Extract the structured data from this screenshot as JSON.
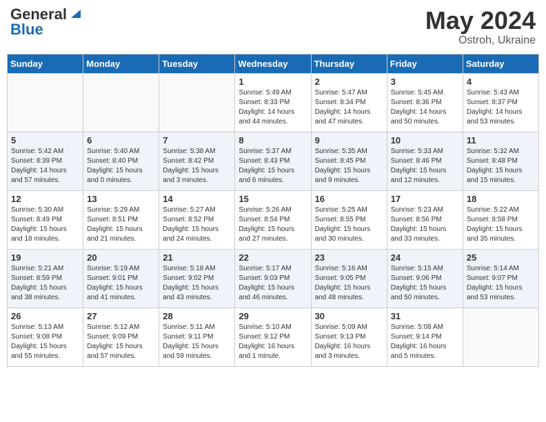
{
  "header": {
    "logo_general": "General",
    "logo_blue": "Blue",
    "month_year": "May 2024",
    "location": "Ostroh, Ukraine"
  },
  "calendar": {
    "days_of_week": [
      "Sunday",
      "Monday",
      "Tuesday",
      "Wednesday",
      "Thursday",
      "Friday",
      "Saturday"
    ],
    "weeks": [
      [
        {
          "day": "",
          "info": ""
        },
        {
          "day": "",
          "info": ""
        },
        {
          "day": "",
          "info": ""
        },
        {
          "day": "1",
          "info": "Sunrise: 5:49 AM\nSunset: 8:33 PM\nDaylight: 14 hours\nand 44 minutes."
        },
        {
          "day": "2",
          "info": "Sunrise: 5:47 AM\nSunset: 8:34 PM\nDaylight: 14 hours\nand 47 minutes."
        },
        {
          "day": "3",
          "info": "Sunrise: 5:45 AM\nSunset: 8:36 PM\nDaylight: 14 hours\nand 50 minutes."
        },
        {
          "day": "4",
          "info": "Sunrise: 5:43 AM\nSunset: 8:37 PM\nDaylight: 14 hours\nand 53 minutes."
        }
      ],
      [
        {
          "day": "5",
          "info": "Sunrise: 5:42 AM\nSunset: 8:39 PM\nDaylight: 14 hours\nand 57 minutes."
        },
        {
          "day": "6",
          "info": "Sunrise: 5:40 AM\nSunset: 8:40 PM\nDaylight: 15 hours\nand 0 minutes."
        },
        {
          "day": "7",
          "info": "Sunrise: 5:38 AM\nSunset: 8:42 PM\nDaylight: 15 hours\nand 3 minutes."
        },
        {
          "day": "8",
          "info": "Sunrise: 5:37 AM\nSunset: 8:43 PM\nDaylight: 15 hours\nand 6 minutes."
        },
        {
          "day": "9",
          "info": "Sunrise: 5:35 AM\nSunset: 8:45 PM\nDaylight: 15 hours\nand 9 minutes."
        },
        {
          "day": "10",
          "info": "Sunrise: 5:33 AM\nSunset: 8:46 PM\nDaylight: 15 hours\nand 12 minutes."
        },
        {
          "day": "11",
          "info": "Sunrise: 5:32 AM\nSunset: 8:48 PM\nDaylight: 15 hours\nand 15 minutes."
        }
      ],
      [
        {
          "day": "12",
          "info": "Sunrise: 5:30 AM\nSunset: 8:49 PM\nDaylight: 15 hours\nand 18 minutes."
        },
        {
          "day": "13",
          "info": "Sunrise: 5:29 AM\nSunset: 8:51 PM\nDaylight: 15 hours\nand 21 minutes."
        },
        {
          "day": "14",
          "info": "Sunrise: 5:27 AM\nSunset: 8:52 PM\nDaylight: 15 hours\nand 24 minutes."
        },
        {
          "day": "15",
          "info": "Sunrise: 5:26 AM\nSunset: 8:54 PM\nDaylight: 15 hours\nand 27 minutes."
        },
        {
          "day": "16",
          "info": "Sunrise: 5:25 AM\nSunset: 8:55 PM\nDaylight: 15 hours\nand 30 minutes."
        },
        {
          "day": "17",
          "info": "Sunrise: 5:23 AM\nSunset: 8:56 PM\nDaylight: 15 hours\nand 33 minutes."
        },
        {
          "day": "18",
          "info": "Sunrise: 5:22 AM\nSunset: 8:58 PM\nDaylight: 15 hours\nand 35 minutes."
        }
      ],
      [
        {
          "day": "19",
          "info": "Sunrise: 5:21 AM\nSunset: 8:59 PM\nDaylight: 15 hours\nand 38 minutes."
        },
        {
          "day": "20",
          "info": "Sunrise: 5:19 AM\nSunset: 9:01 PM\nDaylight: 15 hours\nand 41 minutes."
        },
        {
          "day": "21",
          "info": "Sunrise: 5:18 AM\nSunset: 9:02 PM\nDaylight: 15 hours\nand 43 minutes."
        },
        {
          "day": "22",
          "info": "Sunrise: 5:17 AM\nSunset: 9:03 PM\nDaylight: 15 hours\nand 46 minutes."
        },
        {
          "day": "23",
          "info": "Sunrise: 5:16 AM\nSunset: 9:05 PM\nDaylight: 15 hours\nand 48 minutes."
        },
        {
          "day": "24",
          "info": "Sunrise: 5:15 AM\nSunset: 9:06 PM\nDaylight: 15 hours\nand 50 minutes."
        },
        {
          "day": "25",
          "info": "Sunrise: 5:14 AM\nSunset: 9:07 PM\nDaylight: 15 hours\nand 53 minutes."
        }
      ],
      [
        {
          "day": "26",
          "info": "Sunrise: 5:13 AM\nSunset: 9:08 PM\nDaylight: 15 hours\nand 55 minutes."
        },
        {
          "day": "27",
          "info": "Sunrise: 5:12 AM\nSunset: 9:09 PM\nDaylight: 15 hours\nand 57 minutes."
        },
        {
          "day": "28",
          "info": "Sunrise: 5:11 AM\nSunset: 9:11 PM\nDaylight: 15 hours\nand 59 minutes."
        },
        {
          "day": "29",
          "info": "Sunrise: 5:10 AM\nSunset: 9:12 PM\nDaylight: 16 hours\nand 1 minute."
        },
        {
          "day": "30",
          "info": "Sunrise: 5:09 AM\nSunset: 9:13 PM\nDaylight: 16 hours\nand 3 minutes."
        },
        {
          "day": "31",
          "info": "Sunrise: 5:08 AM\nSunset: 9:14 PM\nDaylight: 16 hours\nand 5 minutes."
        },
        {
          "day": "",
          "info": ""
        }
      ]
    ]
  }
}
